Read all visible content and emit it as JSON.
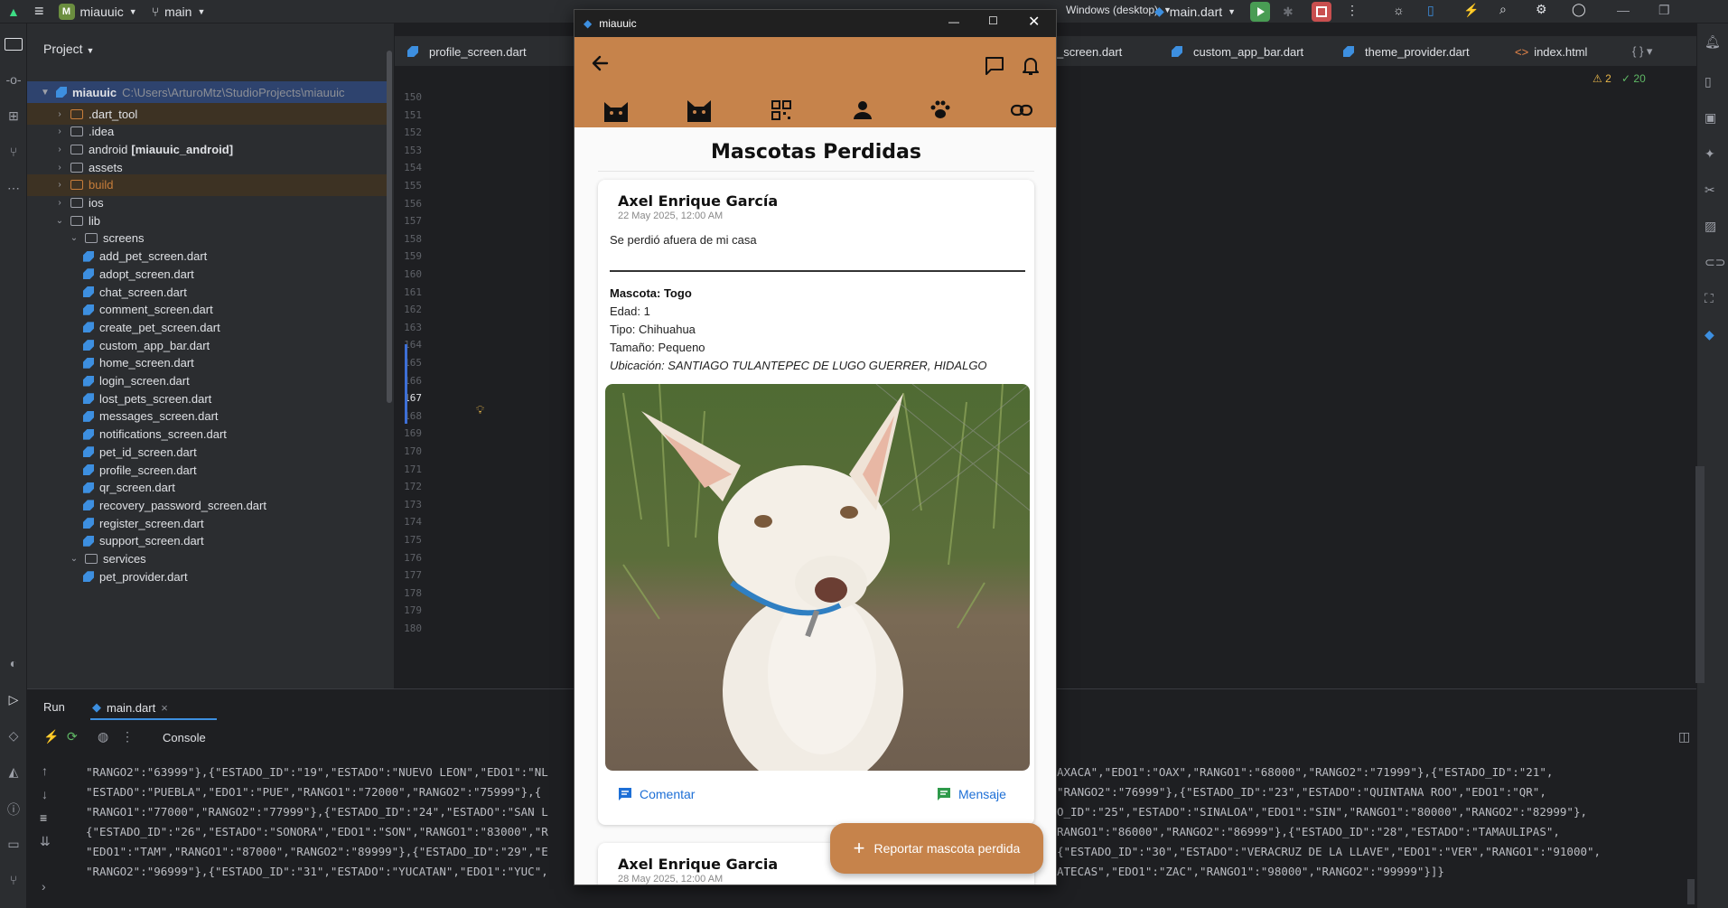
{
  "ide": {
    "project_name": "miauuic",
    "branch": "main",
    "run_config": "main.dart",
    "device": "Windows (desktop)",
    "panel_title": "Project",
    "warnings": "2",
    "checks": "20"
  },
  "tree": {
    "root_name": "miauuic",
    "root_path": "C:\\Users\\ArturoMtz\\StudioProjects\\miauuic",
    "items": [
      {
        "label": ".dart_tool",
        "suffix": ""
      },
      {
        "label": ".idea",
        "suffix": ""
      },
      {
        "label": "android",
        "suffix": "[miauuic_android]"
      },
      {
        "label": "assets",
        "suffix": ""
      },
      {
        "label": "build",
        "suffix": ""
      },
      {
        "label": "ios",
        "suffix": ""
      },
      {
        "label": "lib",
        "suffix": ""
      },
      {
        "label": "screens",
        "suffix": ""
      },
      {
        "label": "add_pet_screen.dart"
      },
      {
        "label": "adopt_screen.dart"
      },
      {
        "label": "chat_screen.dart"
      },
      {
        "label": "comment_screen.dart"
      },
      {
        "label": "create_pet_screen.dart"
      },
      {
        "label": "custom_app_bar.dart"
      },
      {
        "label": "home_screen.dart"
      },
      {
        "label": "login_screen.dart"
      },
      {
        "label": "lost_pets_screen.dart"
      },
      {
        "label": "messages_screen.dart"
      },
      {
        "label": "notifications_screen.dart"
      },
      {
        "label": "pet_id_screen.dart"
      },
      {
        "label": "profile_screen.dart"
      },
      {
        "label": "qr_screen.dart"
      },
      {
        "label": "recovery_password_screen.dart"
      },
      {
        "label": "register_screen.dart"
      },
      {
        "label": "support_screen.dart"
      },
      {
        "label": "services",
        "suffix": ""
      },
      {
        "label": "pet_provider.dart"
      }
    ]
  },
  "editor_tabs": [
    "profile_screen.dart",
    "_screen.dart",
    "custom_app_bar.dart",
    "theme_provider.dart",
    "index.html"
  ],
  "line_numbers": [
    "150",
    "151",
    "152",
    "153",
    "154",
    "155",
    "156",
    "157",
    "158",
    "159",
    "160",
    "161",
    "162",
    "163",
    "164",
    "165",
    "166",
    "167",
    "168",
    "169",
    "170",
    "171",
    "172",
    "173",
    "174",
    "175",
    "176",
    "177",
    "178",
    "179",
    "180"
  ],
  "run": {
    "tab_run": "Run",
    "tab_main": "main.dart",
    "console_label": "Console",
    "lines": [
      "\"RANGO2\":\"63999\"},{\"ESTADO_ID\":\"19\",\"ESTADO\":\"NUEVO LEON\",\"EDO1\":\"NL",
      "\"ESTADO\":\"PUEBLA\",\"EDO1\":\"PUE\",\"RANGO1\":\"72000\",\"RANGO2\":\"75999\"},{",
      "\"RANGO1\":\"77000\",\"RANGO2\":\"77999\"},{\"ESTADO_ID\":\"24\",\"ESTADO\":\"SAN L",
      "{\"ESTADO_ID\":\"26\",\"ESTADO\":\"SONORA\",\"EDO1\":\"SON\",\"RANGO1\":\"83000\",\"R",
      "\"EDO1\":\"TAM\",\"RANGO1\":\"87000\",\"RANGO2\":\"89999\"},{\"ESTADO_ID\":\"29\",\"E",
      "\"RANGO2\":\"96999\"},{\"ESTADO_ID\":\"31\",\"ESTADO\":\"YUCATAN\",\"EDO1\":\"YUC\","
    ],
    "lines_right": [
      "AXACA\",\"EDO1\":\"OAX\",\"RANGO1\":\"68000\",\"RANGO2\":\"71999\"},{\"ESTADO_ID\":\"21\",",
      "\"RANGO2\":\"76999\"},{\"ESTADO_ID\":\"23\",\"ESTADO\":\"QUINTANA ROO\",\"EDO1\":\"QR\",",
      "O_ID\":\"25\",\"ESTADO\":\"SINALOA\",\"EDO1\":\"SIN\",\"RANGO1\":\"80000\",\"RANGO2\":\"82999\"},",
      "RANGO1\":\"86000\",\"RANGO2\":\"86999\"},{\"ESTADO_ID\":\"28\",\"ESTADO\":\"TAMAULIPAS\",",
      "{\"ESTADO_ID\":\"30\",\"ESTADO\":\"VERACRUZ DE LA LLAVE\",\"EDO1\":\"VER\",\"RANGO1\":\"91000\",",
      "ATECAS\",\"EDO1\":\"ZAC\",\"RANGO1\":\"98000\",\"RANGO2\":\"99999\"}]}"
    ]
  },
  "app": {
    "window_title": "miauuic",
    "screen_title": "Mascotas Perdidas",
    "accent": "#c6834b",
    "posts": [
      {
        "author": "Axel Enrique García",
        "date": "22 May 2025, 12:00 AM",
        "description": "Se perdió afuera de mi casa",
        "pet_line": "Mascota: Togo",
        "age": "Edad: 1",
        "type": "Tipo: Chihuahua",
        "size": "Tamaño: Pequeno",
        "location": "Ubicación: SANTIAGO TULANTEPEC DE LUGO GUERRER, HIDALGO",
        "comment_label": "Comentar",
        "message_label": "Mensaje"
      },
      {
        "author": "Axel Enrique Garcia",
        "date": "28 May 2025, 12:00 AM"
      }
    ],
    "fab_label": "Reportar mascota perdida"
  }
}
